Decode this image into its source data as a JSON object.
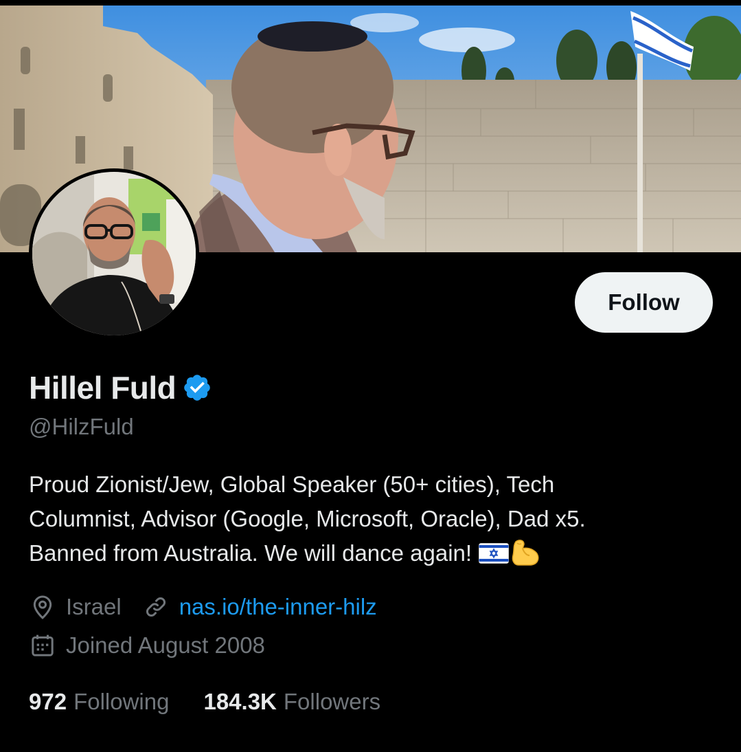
{
  "profile": {
    "display_name": "Hillel Fuld",
    "handle": "@HilzFuld",
    "verified": true,
    "bio_lines": [
      "Proud Zionist/Jew, Global Speaker (50+ cities), Tech",
      "Columnist, Advisor (Google, Microsoft, Oracle), Dad x5.",
      "Banned from Australia. We will dance again!"
    ],
    "bio_emojis": [
      "israel-flag-icon",
      "flexed-biceps-icon"
    ],
    "location": "Israel",
    "website": "nas.io/the-inner-hilz",
    "joined": "Joined August 2008"
  },
  "stats": {
    "following_count": "972",
    "following_label": "Following",
    "followers_count": "184.3K",
    "followers_label": "Followers"
  },
  "actions": {
    "follow_label": "Follow"
  },
  "icons": {
    "location": "map-pin-icon",
    "website": "link-icon",
    "joined": "calendar-icon",
    "verified": "verified-badge-icon"
  },
  "colors": {
    "background": "#000000",
    "primary_text": "#e7e9ea",
    "secondary_text": "#71767b",
    "link": "#1d9bf0",
    "verified_badge": "#1d9bf0",
    "follow_button_bg": "#eff3f4"
  }
}
